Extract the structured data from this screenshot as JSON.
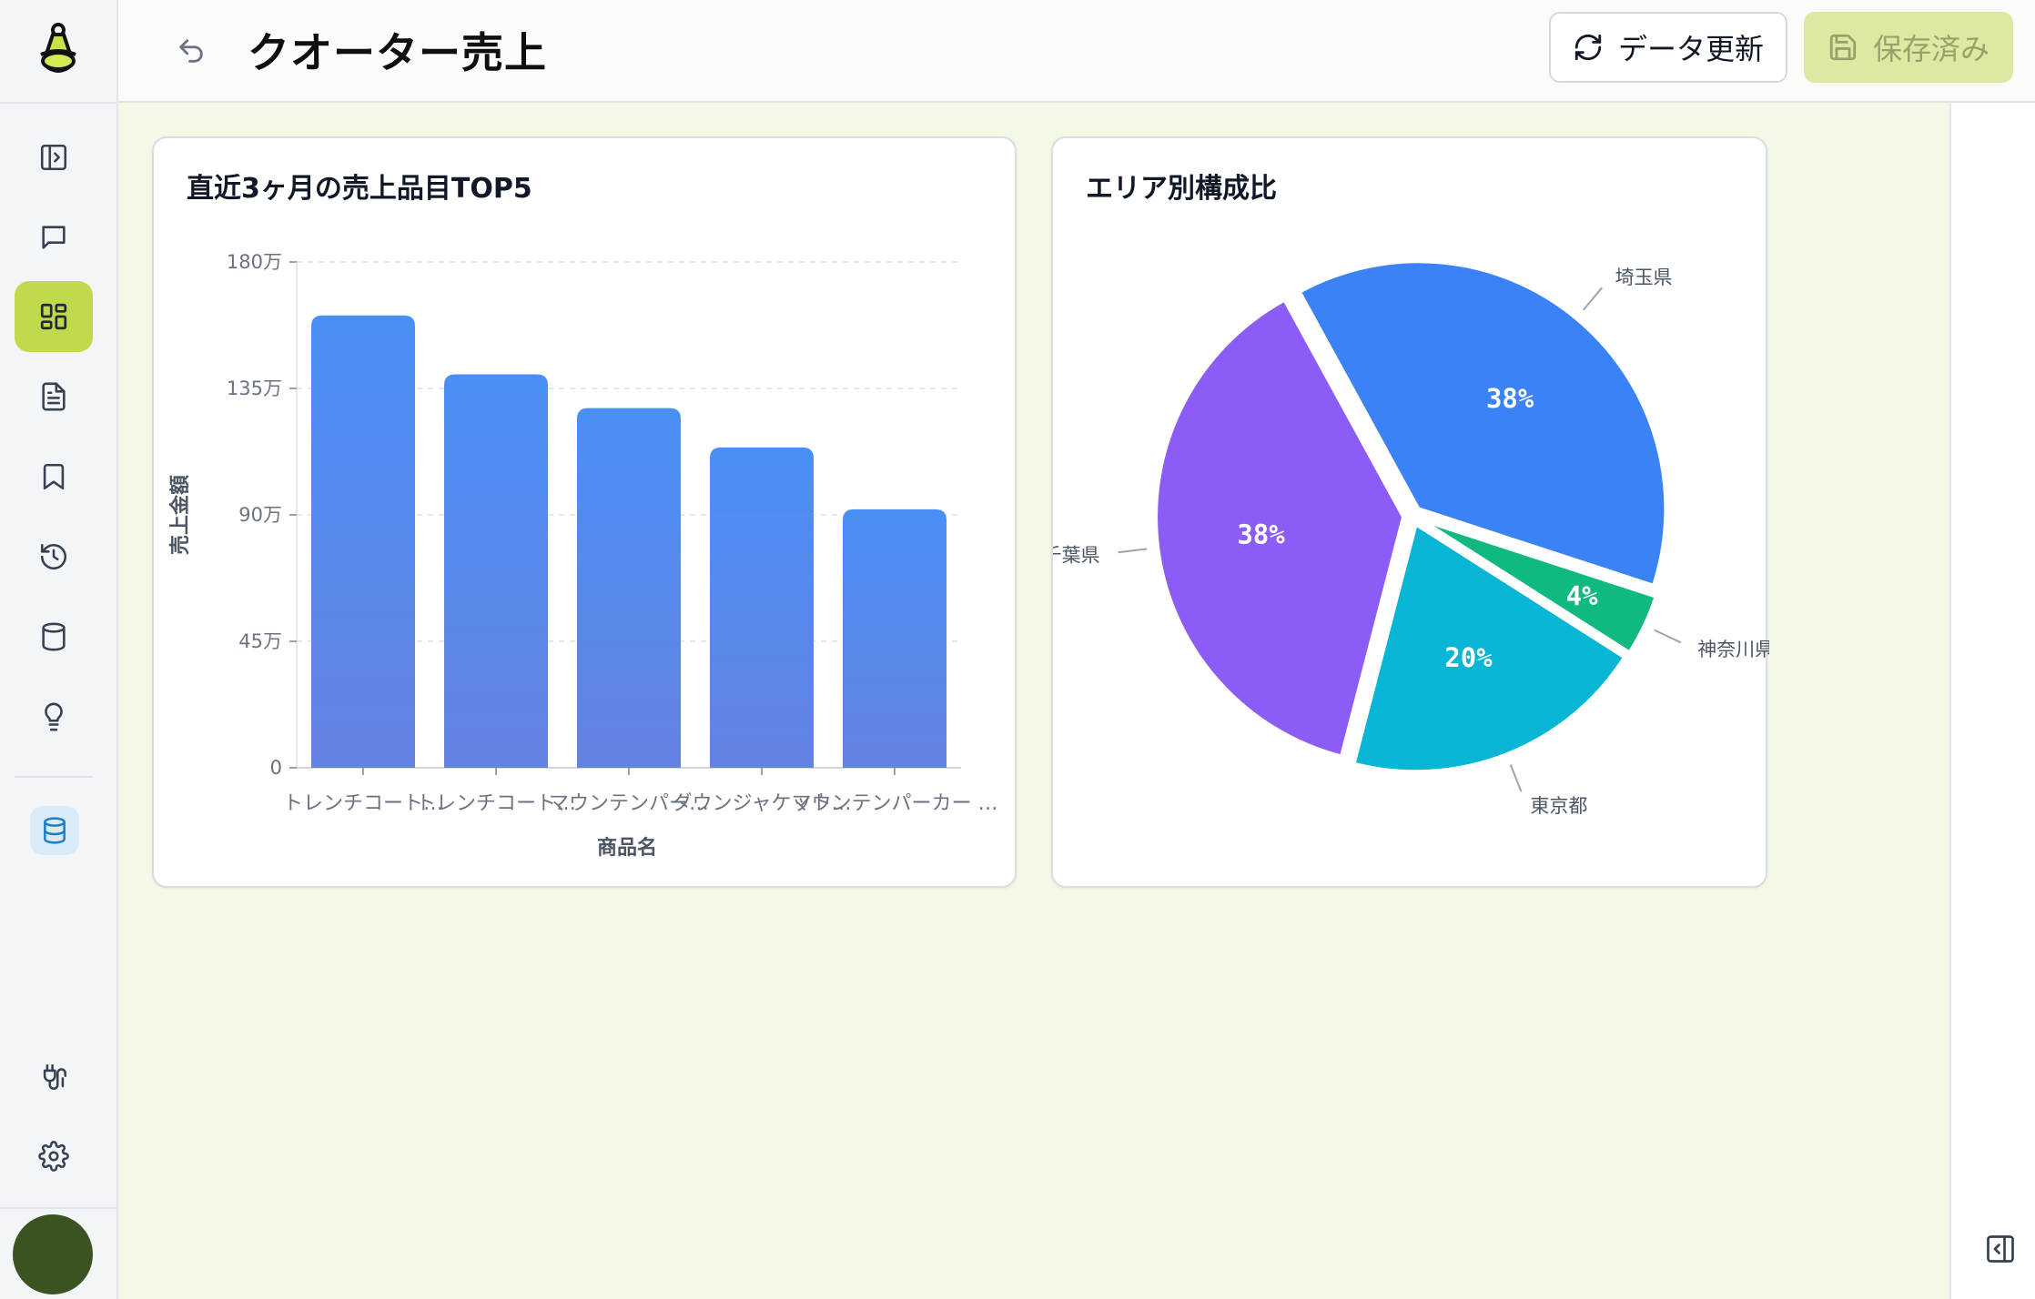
{
  "header": {
    "title": "クオーター売上",
    "refresh_label": "データ更新",
    "saved_label": "保存済み"
  },
  "sidebar": {
    "items": [
      {
        "name": "panel-toggle",
        "icon": "sidebar-toggle-icon"
      },
      {
        "name": "chat",
        "icon": "chat-icon"
      },
      {
        "name": "dashboard",
        "icon": "dashboard-icon",
        "active": true
      },
      {
        "name": "documents",
        "icon": "document-icon"
      },
      {
        "name": "bookmarks",
        "icon": "bookmark-icon"
      },
      {
        "name": "history",
        "icon": "history-icon"
      },
      {
        "name": "database",
        "icon": "database-icon"
      },
      {
        "name": "ideas",
        "icon": "lightbulb-icon"
      },
      {
        "name": "datasource",
        "icon": "database-icon"
      },
      {
        "name": "integrations",
        "icon": "plug-icon"
      },
      {
        "name": "settings",
        "icon": "gear-icon"
      }
    ]
  },
  "colors": {
    "accent": "#c1d94d",
    "bar_top": "#4a8ff5",
    "bar_bottom": "#6482e3",
    "main_bg": "#f4f8e7"
  },
  "charts": {
    "bar": {
      "title": "直近3ヶ月の売上品目TOP5",
      "xlabel": "商品名",
      "ylabel": "売上金額",
      "tick_labels": [
        "0",
        "45万",
        "90万",
        "135万",
        "180万"
      ],
      "category_labels": [
        "トレンチコート…",
        "トレンチコート…",
        "マウンテンパー…",
        "ダウンジャケット…",
        "マウンテンパーカー …"
      ]
    },
    "pie": {
      "title": "エリア別構成比",
      "labels": [
        "埼玉県",
        "神奈川県",
        "東京都",
        "千葉県"
      ],
      "pct_labels": [
        "38%",
        "4%",
        "20%",
        "38%"
      ]
    }
  },
  "chart_data": [
    {
      "type": "bar",
      "title": "直近3ヶ月の売上品目TOP5",
      "xlabel": "商品名",
      "ylabel": "売上金額",
      "categories": [
        "トレンチコート…",
        "トレンチコート…",
        "マウンテンパー…",
        "ダウンジャケット…",
        "マウンテンパーカー …"
      ],
      "values": [
        1610000,
        1400000,
        1280000,
        1140000,
        920000
      ],
      "ylim": [
        0,
        1800000
      ],
      "yticks": [
        0,
        450000,
        900000,
        1350000,
        1800000
      ],
      "grid": true
    },
    {
      "type": "pie",
      "title": "エリア別構成比",
      "labels": [
        "埼玉県",
        "神奈川県",
        "東京都",
        "千葉県"
      ],
      "values": [
        38,
        4,
        20,
        38
      ],
      "colors": [
        "#3b82f6",
        "#10b981",
        "#06b6d4",
        "#8b5cf6"
      ],
      "exploded": true
    }
  ]
}
